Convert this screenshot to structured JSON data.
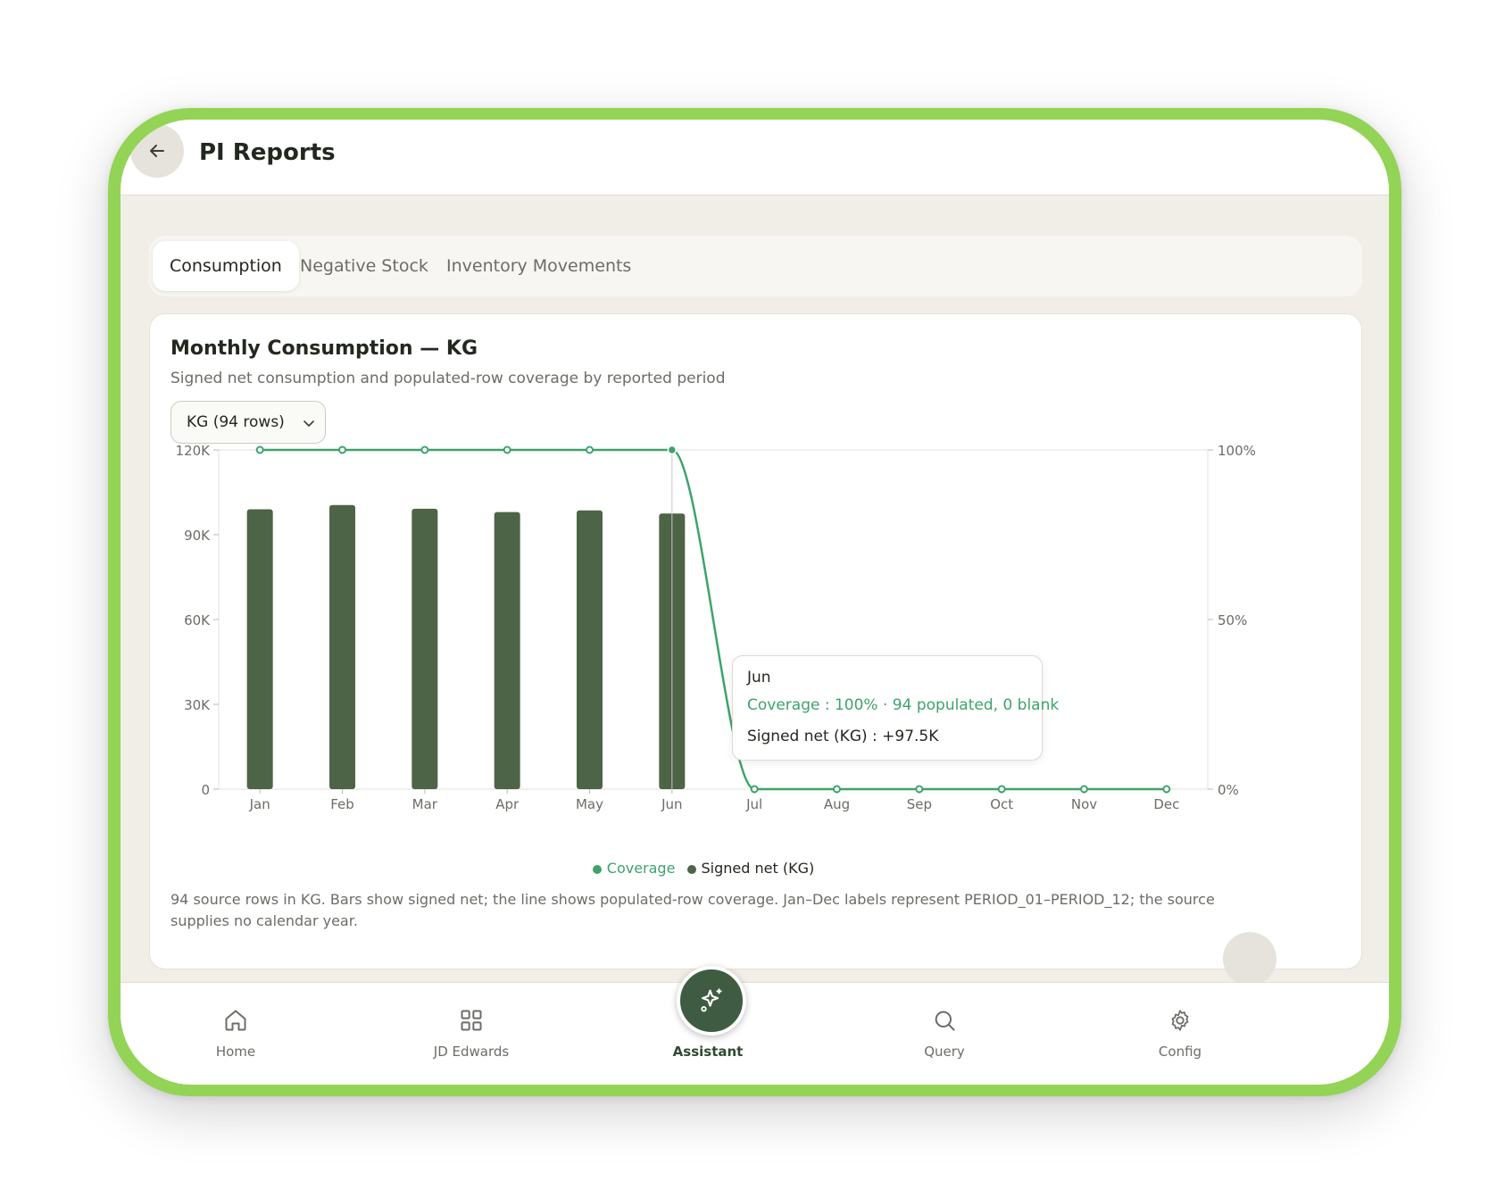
{
  "header": {
    "title": "PI Reports"
  },
  "tabs": [
    {
      "label": "Consumption",
      "active": true
    },
    {
      "label": "Negative Stock",
      "active": false
    },
    {
      "label": "Inventory Movements",
      "active": false
    }
  ],
  "card": {
    "title": "Monthly Consumption — KG",
    "subtitle": "Signed net consumption and populated-row coverage by reported period",
    "unit_select": {
      "value": "KG (94 rows)"
    },
    "footnote": "94 source rows in KG. Bars show signed net; the line shows populated-row coverage. Jan–Dec labels represent PERIOD_01–PERIOD_12; the source supplies no calendar year."
  },
  "tooltip": {
    "title": "Jun",
    "coverage": "Coverage : 100% · 94 populated, 0 blank",
    "signed_net": "Signed net (KG) : +97.5K"
  },
  "chart_data": {
    "type": "bar",
    "categories": [
      "Jan",
      "Feb",
      "Mar",
      "Apr",
      "May",
      "Jun",
      "Jul",
      "Aug",
      "Sep",
      "Oct",
      "Nov",
      "Dec"
    ],
    "series": [
      {
        "name": "Signed net (KG)",
        "type": "bar",
        "axis": "left",
        "color": "#4d6446",
        "values": [
          99000,
          100500,
          99200,
          98000,
          98600,
          97500,
          0,
          0,
          0,
          0,
          0,
          0
        ]
      },
      {
        "name": "Coverage",
        "type": "line",
        "axis": "right",
        "color": "#3ea36b",
        "values": [
          100,
          100,
          100,
          100,
          100,
          100,
          0,
          0,
          0,
          0,
          0,
          0
        ]
      }
    ],
    "y_left": {
      "ticks": [
        "0",
        "30K",
        "60K",
        "90K",
        "120K"
      ],
      "range": [
        0,
        120000
      ]
    },
    "y_right": {
      "ticks": [
        "0%",
        "50%",
        "100%"
      ],
      "range": [
        0,
        100
      ]
    },
    "highlighted_category": "Jun",
    "legend": [
      "Coverage",
      "Signed net (KG)"
    ],
    "legend_position": "bottom"
  },
  "colors": {
    "accent": "#93d356",
    "bar": "#4d6446",
    "line": "#3ea36b"
  },
  "bottom_nav": [
    {
      "label": "Home",
      "icon": "home-icon"
    },
    {
      "label": "JD Edwards",
      "icon": "grid-icon"
    },
    {
      "label": "Assistant",
      "icon": "sparkle-icon"
    },
    {
      "label": "Query",
      "icon": "search-icon"
    },
    {
      "label": "Config",
      "icon": "gear-icon"
    }
  ]
}
